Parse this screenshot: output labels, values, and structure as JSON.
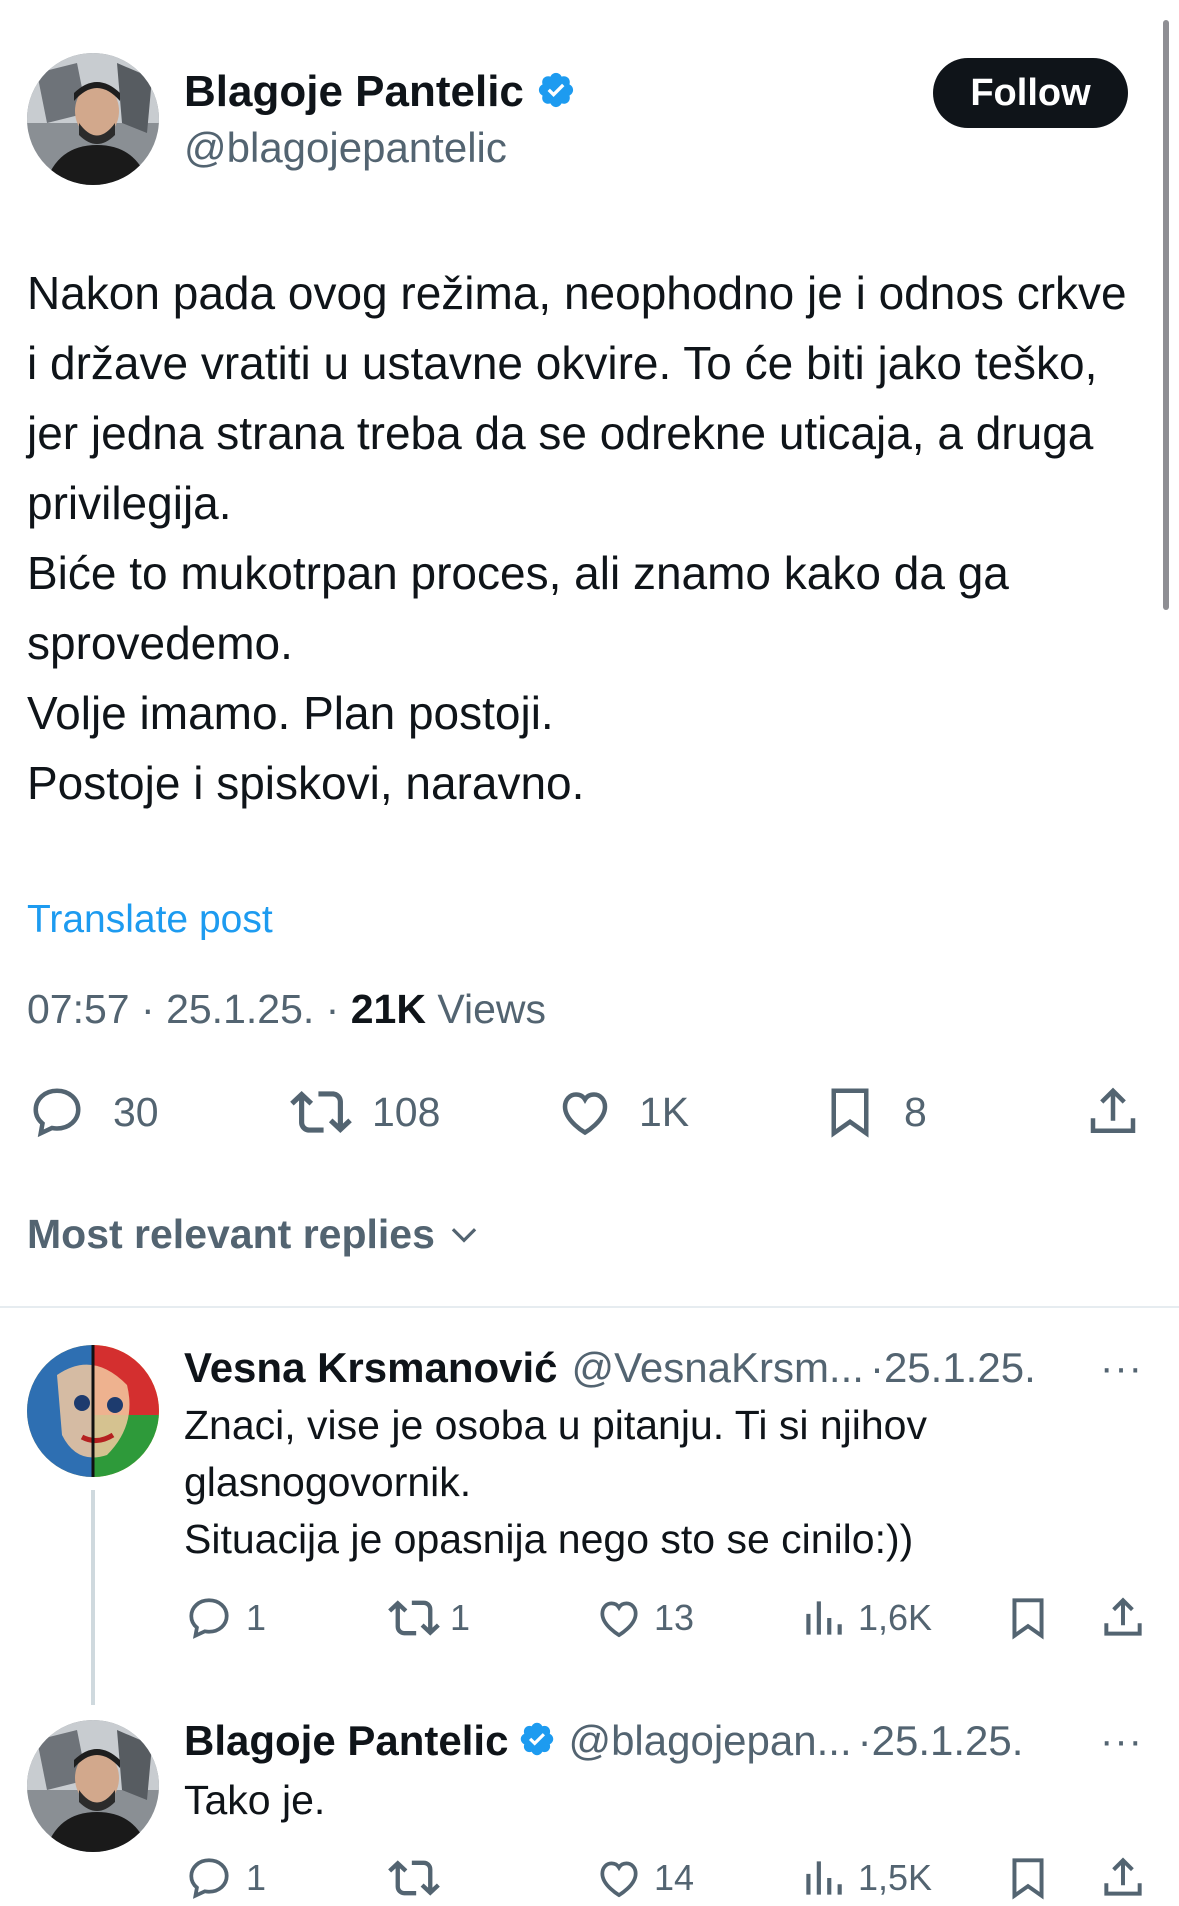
{
  "author": {
    "name": "Blagoje Pantelic",
    "handle": "@blagojepantelic",
    "follow_label": "Follow"
  },
  "tweet": {
    "text": "Nakon pada ovog režima, neophodno je i odnos crkve i države vratiti u ustavne okvire. To će biti jako teško, jer jedna strana treba da se odrekne uticaja, a druga privilegija.\nBiće to mukotrpan proces, ali znamo kako da ga sprovedemo.\nVolje imamo. Plan postoji.\nPostoje i spiskovi, naravno.",
    "translate_label": "Translate post",
    "time": "07:57",
    "date": "25.1.25.",
    "views_count": "21K",
    "views_label": "Views",
    "stats": {
      "replies": "30",
      "reposts": "108",
      "likes": "1K",
      "bookmarks": "8"
    }
  },
  "replies_header": "Most relevant replies",
  "replies": [
    {
      "name": "Vesna Krsmanović",
      "handle": "@VesnaKrsm...",
      "date": "25.1.25.",
      "text": "Znaci, vise je osoba u pitanju. Ti si    njihov\nglasnogovornik.\n Situacija je opasnija nego sto se cinilo:))",
      "replies": "1",
      "reposts": "1",
      "likes": "13",
      "views": "1,6K"
    },
    {
      "name": "Blagoje Pantelic",
      "handle": "@blagojepan...",
      "date": "25.1.25.",
      "text": "Tako je.",
      "replies": "1",
      "likes": "14",
      "views": "1,5K"
    }
  ],
  "separator": "·",
  "more_icon": "···",
  "colors": {
    "accent": "#1d9bf0",
    "text": "#0f1419",
    "muted": "#536471",
    "border": "#eff3f4"
  }
}
